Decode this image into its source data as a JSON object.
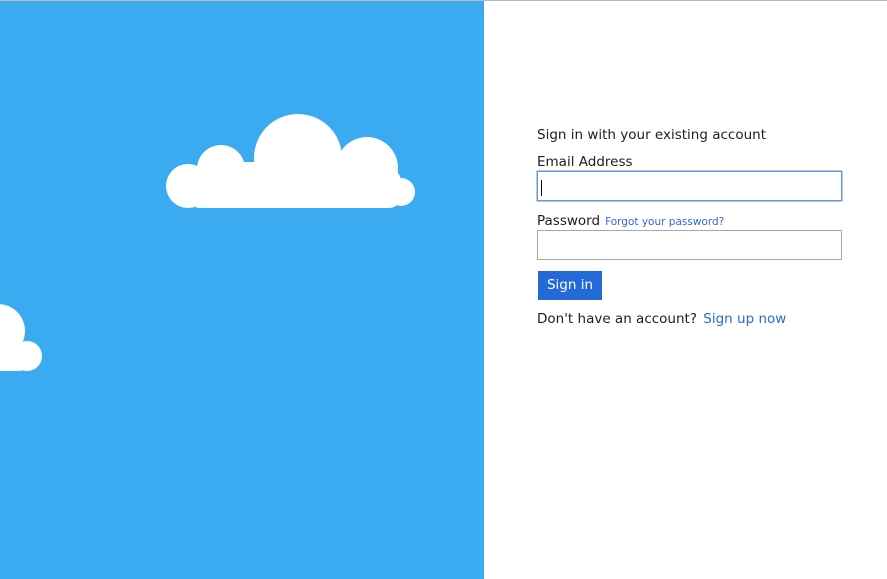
{
  "hero": {
    "background_color": "#3babf1",
    "cloud_color": "#ffffff"
  },
  "form": {
    "intro_text": "Sign in with your existing account",
    "email_label": "Email Address",
    "email_value": "",
    "password_label": "Password",
    "forgot_link": "Forgot your password?",
    "password_value": "",
    "signin_button": "Sign in",
    "signup_prompt": "Don't have an account?",
    "signup_link": "Sign up now",
    "accent_color": "#2369d8"
  }
}
